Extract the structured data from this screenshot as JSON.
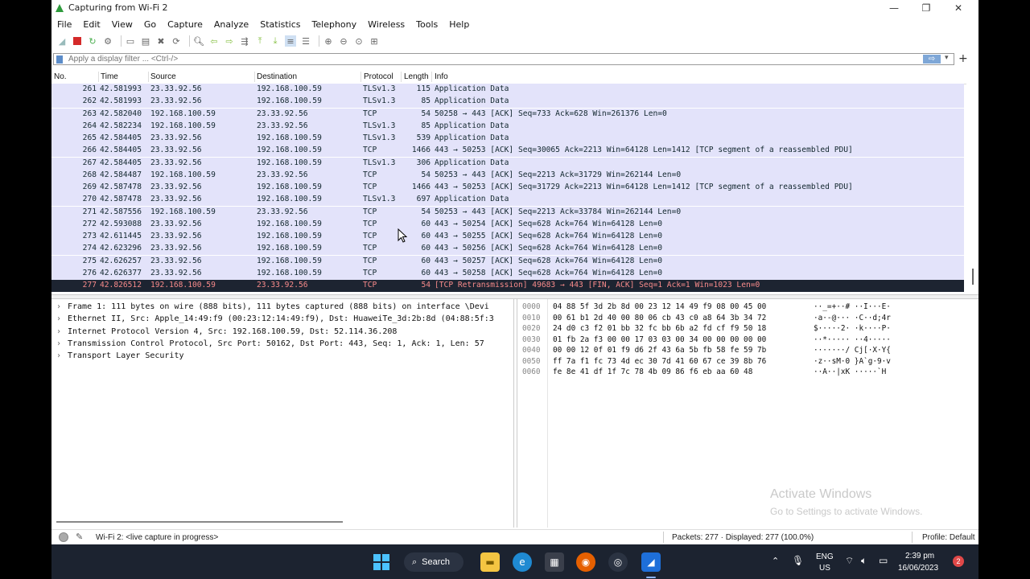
{
  "window": {
    "title": "Capturing from Wi-Fi 2"
  },
  "menu": [
    "File",
    "Edit",
    "View",
    "Go",
    "Capture",
    "Analyze",
    "Statistics",
    "Telephony",
    "Wireless",
    "Tools",
    "Help"
  ],
  "filter": {
    "placeholder": "Apply a display filter ... <Ctrl-/>"
  },
  "columns": {
    "no": "No.",
    "time": "Time",
    "source": "Source",
    "destination": "Destination",
    "protocol": "Protocol",
    "length": "Length",
    "info": "Info"
  },
  "packets": [
    {
      "no": "261",
      "time": "42.581993",
      "src": "23.33.92.56",
      "dst": "192.168.100.59",
      "proto": "TLSv1.3",
      "len": "115",
      "info": "Application Data"
    },
    {
      "no": "262",
      "time": "42.581993",
      "src": "23.33.92.56",
      "dst": "192.168.100.59",
      "proto": "TLSv1.3",
      "len": "85",
      "info": "Application Data"
    },
    {
      "no": "263",
      "time": "42.582040",
      "src": "192.168.100.59",
      "dst": "23.33.92.56",
      "proto": "TCP",
      "len": "54",
      "info": "50258 → 443 [ACK] Seq=733 Ack=628 Win=261376 Len=0"
    },
    {
      "no": "264",
      "time": "42.582234",
      "src": "192.168.100.59",
      "dst": "23.33.92.56",
      "proto": "TLSv1.3",
      "len": "85",
      "info": "Application Data"
    },
    {
      "no": "265",
      "time": "42.584405",
      "src": "23.33.92.56",
      "dst": "192.168.100.59",
      "proto": "TLSv1.3",
      "len": "539",
      "info": "Application Data"
    },
    {
      "no": "266",
      "time": "42.584405",
      "src": "23.33.92.56",
      "dst": "192.168.100.59",
      "proto": "TCP",
      "len": "1466",
      "info": "443 → 50253 [ACK] Seq=30065 Ack=2213 Win=64128 Len=1412 [TCP segment of a reassembled PDU]"
    },
    {
      "no": "267",
      "time": "42.584405",
      "src": "23.33.92.56",
      "dst": "192.168.100.59",
      "proto": "TLSv1.3",
      "len": "306",
      "info": "Application Data"
    },
    {
      "no": "268",
      "time": "42.584487",
      "src": "192.168.100.59",
      "dst": "23.33.92.56",
      "proto": "TCP",
      "len": "54",
      "info": "50253 → 443 [ACK] Seq=2213 Ack=31729 Win=262144 Len=0"
    },
    {
      "no": "269",
      "time": "42.587478",
      "src": "23.33.92.56",
      "dst": "192.168.100.59",
      "proto": "TCP",
      "len": "1466",
      "info": "443 → 50253 [ACK] Seq=31729 Ack=2213 Win=64128 Len=1412 [TCP segment of a reassembled PDU]"
    },
    {
      "no": "270",
      "time": "42.587478",
      "src": "23.33.92.56",
      "dst": "192.168.100.59",
      "proto": "TLSv1.3",
      "len": "697",
      "info": "Application Data"
    },
    {
      "no": "271",
      "time": "42.587556",
      "src": "192.168.100.59",
      "dst": "23.33.92.56",
      "proto": "TCP",
      "len": "54",
      "info": "50253 → 443 [ACK] Seq=2213 Ack=33784 Win=262144 Len=0"
    },
    {
      "no": "272",
      "time": "42.593088",
      "src": "23.33.92.56",
      "dst": "192.168.100.59",
      "proto": "TCP",
      "len": "60",
      "info": "443 → 50254 [ACK] Seq=628 Ack=764 Win=64128 Len=0"
    },
    {
      "no": "273",
      "time": "42.611445",
      "src": "23.33.92.56",
      "dst": "192.168.100.59",
      "proto": "TCP",
      "len": "60",
      "info": "443 → 50255 [ACK] Seq=628 Ack=764 Win=64128 Len=0"
    },
    {
      "no": "274",
      "time": "42.623296",
      "src": "23.33.92.56",
      "dst": "192.168.100.59",
      "proto": "TCP",
      "len": "60",
      "info": "443 → 50256 [ACK] Seq=628 Ack=764 Win=64128 Len=0"
    },
    {
      "no": "275",
      "time": "42.626257",
      "src": "23.33.92.56",
      "dst": "192.168.100.59",
      "proto": "TCP",
      "len": "60",
      "info": "443 → 50257 [ACK] Seq=628 Ack=764 Win=64128 Len=0"
    },
    {
      "no": "276",
      "time": "42.626377",
      "src": "23.33.92.56",
      "dst": "192.168.100.59",
      "proto": "TCP",
      "len": "60",
      "info": "443 → 50258 [ACK] Seq=628 Ack=764 Win=64128 Len=0"
    },
    {
      "no": "277",
      "time": "42.826512",
      "src": "192.168.100.59",
      "dst": "23.33.92.56",
      "proto": "TCP",
      "len": "54",
      "info": "[TCP Retransmission] 49683 → 443 [FIN, ACK] Seq=1 Ack=1 Win=1023 Len=0",
      "selected": true
    }
  ],
  "details": [
    "Frame 1: 111 bytes on wire (888 bits), 111 bytes captured (888 bits) on interface \\Devi",
    "Ethernet II, Src: Apple_14:49:f9 (00:23:12:14:49:f9), Dst: HuaweiTe_3d:2b:8d (04:88:5f:3",
    "Internet Protocol Version 4, Src: 192.168.100.59, Dst: 52.114.36.208",
    "Transmission Control Protocol, Src Port: 50162, Dst Port: 443, Seq: 1, Ack: 1, Len: 57",
    "Transport Layer Security"
  ],
  "bytes": [
    {
      "off": "0000",
      "hex": "04 88 5f 3d 2b 8d 00 23  12 14 49 f9 08 00 45 00",
      "ascii": "··_=+··#  ··I···E·"
    },
    {
      "off": "0010",
      "hex": "00 61 b1 2d 40 00 80 06  cb 43 c0 a8 64 3b 34 72",
      "ascii": "·a·-@···  ·C··d;4r"
    },
    {
      "off": "0020",
      "hex": "24 d0 c3 f2 01 bb 32 fc  bb 6b a2 fd cf f9 50 18",
      "ascii": "$·····2·  ·k····P·"
    },
    {
      "off": "0030",
      "hex": "01 fb 2a f3 00 00 17 03  03 00 34 00 00 00 00 00",
      "ascii": "··*·····  ··4·····"
    },
    {
      "off": "0040",
      "hex": "00 00 12 0f 01 f9 d6 2f  43 6a 5b fb 58 fe 59 7b",
      "ascii": "·······/  Cj[·X·Y{"
    },
    {
      "off": "0050",
      "hex": "ff 7a f1 fc 73 4d ec 30  7d 41 60 67 ce 39 8b 76",
      "ascii": "·z··sM·0  }A`g·9·v"
    },
    {
      "off": "0060",
      "hex": "fe 8e 41 df 1f 7c 78 4b  09 86 f6 eb aa 60 48",
      "ascii": "··A··|xK  ·····`H"
    }
  ],
  "watermark": {
    "line1": "Activate Windows",
    "line2": "Go to Settings to activate Windows."
  },
  "status": {
    "capture": "Wi-Fi 2: <live capture in progress>",
    "packets": "Packets: 277 · Displayed: 277 (100.0%)",
    "profile": "Profile: Default"
  },
  "taskbar": {
    "search": "Search",
    "lang1": "ENG",
    "lang2": "US",
    "time": "2:39 pm",
    "date": "16/06/2023",
    "badge": "2"
  },
  "colors": {
    "row_bg": "#e3e3fa",
    "selected_bg": "#1d2431",
    "selected_fg": "#f78a8a",
    "text": "#12272e"
  }
}
